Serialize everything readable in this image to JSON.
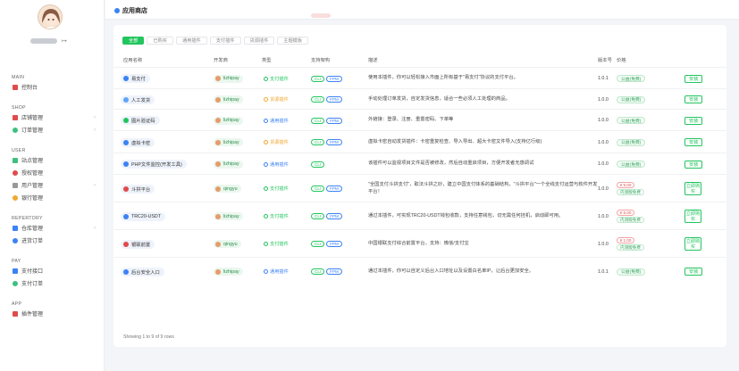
{
  "sidebar": {
    "logout_icon": "logout-icon",
    "sections": [
      {
        "label": "MAIN",
        "items": [
          {
            "label": "控制台",
            "icon": "home-icon",
            "color": "#e04b4b",
            "chevron": false
          }
        ]
      },
      {
        "label": "SHOP",
        "items": [
          {
            "label": "店铺管理",
            "icon": "shop-icon",
            "color": "#e04b4b",
            "chevron": true
          },
          {
            "label": "订单管理",
            "icon": "order-icon",
            "color": "#3fbf7f",
            "chevron": true
          }
        ]
      },
      {
        "label": "USER",
        "items": [
          {
            "label": "站点管理",
            "icon": "globe-icon",
            "color": "#3fbf7f",
            "chevron": false
          },
          {
            "label": "授权管理",
            "icon": "auth-icon",
            "color": "#e04b4b",
            "chevron": false
          },
          {
            "label": "用户管理",
            "icon": "users-icon",
            "color": "#999999",
            "chevron": true
          },
          {
            "label": "银行管理",
            "icon": "bank-icon",
            "color": "#f0a830",
            "chevron": false
          }
        ]
      },
      {
        "label": "REPERTORY",
        "items": [
          {
            "label": "仓库管理",
            "icon": "warehouse-icon",
            "color": "#3b82f6",
            "chevron": true
          },
          {
            "label": "进货订单",
            "icon": "purchase-icon",
            "color": "#3b82f6",
            "chevron": false
          }
        ]
      },
      {
        "label": "PAY",
        "items": [
          {
            "label": "支付接口",
            "icon": "pay-api-icon",
            "color": "#3b82f6",
            "chevron": false
          },
          {
            "label": "支付订单",
            "icon": "pay-order-icon",
            "color": "#3fbf7f",
            "chevron": false
          }
        ]
      },
      {
        "label": "APP",
        "items": [
          {
            "label": "插件管理",
            "icon": "plugin-icon",
            "color": "#e04b4b",
            "chevron": false
          }
        ]
      }
    ]
  },
  "header": {
    "title": "应用商店"
  },
  "tabs": [
    "全部",
    "已购买",
    "通用插件",
    "支付插件",
    "货源插件",
    "主题模板"
  ],
  "active_tab": 0,
  "columns": [
    "应用名称",
    "开发商",
    "类型",
    "支持架构",
    "描述",
    "版本号",
    "价格"
  ],
  "rows": [
    {
      "name": "易支付",
      "icon_color": "#3b82f6",
      "dev": "lizhipay",
      "type": "支付插件",
      "type_color": "#22c55e",
      "fw": [
        "CLI",
        "FPM"
      ],
      "desc": "使用本插件，你可以轻松接入市面上所有基于\"易支付\"协议的支付平台。",
      "version": "1.0.1",
      "price": "公益(免费)",
      "action": "安装",
      "paid": false
    },
    {
      "name": "人工发货",
      "icon_color": "#60a5fa",
      "dev": "lizhipay",
      "type": "货源插件",
      "type_color": "#f0a830",
      "fw": [
        "CLI",
        "FPM"
      ],
      "desc": "手动处理订单发货，自定发货信息，适合一些必须人工处理的商品。",
      "version": "1.0.0",
      "price": "公益(免费)",
      "action": "安装",
      "paid": false
    },
    {
      "name": "图片验证码",
      "icon_color": "#22c55e",
      "dev": "lizhipay",
      "type": "通用插件",
      "type_color": "#3b82f6",
      "fw": [
        "CLI",
        "FPM"
      ],
      "desc": "外链接：登录、注册、重置密码、下单等",
      "version": "1.0.0",
      "price": "公益(免费)",
      "action": "安装",
      "paid": false
    },
    {
      "name": "虚拟卡密",
      "icon_color": "#3b82f6",
      "dev": "lizhipay",
      "type": "货源插件",
      "type_color": "#f0a830",
      "fw": [
        "CLI",
        "FPM"
      ],
      "desc": "虚拟卡密自动发货插件：卡密重复检查、导入导出、超大卡密文件导入(支持亿行级)",
      "version": "1.0.0",
      "price": "公益(免费)",
      "action": "安装",
      "paid": false
    },
    {
      "name": "PHP文件监控(开发工具)",
      "icon_color": "#3b82f6",
      "dev": "lizhipay",
      "type": "通用插件",
      "type_color": "#3b82f6",
      "fw": [
        "CLI"
      ],
      "desc": "该插件可以监视项目文件是否被修改，然后自动重启项目，方便开发者无感调试",
      "version": "1.0.0",
      "price": "公益(免费)",
      "action": "安装",
      "paid": false
    },
    {
      "name": "斗拱平台",
      "icon_color": "#e04b4b",
      "dev": "qingyu",
      "type": "支付插件",
      "type_color": "#22c55e",
      "fw": [
        "CLI",
        "FPM"
      ],
      "desc": "\"全国支付斗拱支付\"，取法斗拱之妙，建立中国支付体系的基础结构，\"斗拱平台\"一个全线支付运营与软件开发平台！",
      "version": "1.0.0",
      "price": "¥ 5.00",
      "price_sub": "内测版免费",
      "action": "立即购买",
      "paid": true
    },
    {
      "name": "TRC20-USDT",
      "icon_color": "#3b82f6",
      "dev": "lizhipay",
      "type": "支付插件",
      "type_color": "#22c55e",
      "fw": [
        "CLI",
        "FPM"
      ],
      "desc": "通过本插件，可实现TRC20-USDT钱包收款，支持任意钱包，切无需任何挂机，启动即可用。",
      "version": "1.0.0",
      "price": "¥ 5.00",
      "price_sub": "内测版免费",
      "action": "立即购买",
      "paid": true
    },
    {
      "name": "银联前置",
      "icon_color": "#e04b4b",
      "dev": "qingyu",
      "type": "支付插件",
      "type_color": "#22c55e",
      "fw": [
        "CLI",
        "FPM"
      ],
      "desc": "中国银联支付综合前置平台，支持：微信/支付宝",
      "version": "1.0.0",
      "price": "¥ 1.00",
      "price_sub": "内测版免费",
      "action": "立即购买",
      "paid": true
    },
    {
      "name": "后台安全入口",
      "icon_color": "#3b82f6",
      "dev": "lizhipay",
      "type": "通用插件",
      "type_color": "#3b82f6",
      "fw": [
        "CLI",
        "FPM"
      ],
      "desc": "通过本插件，你可以自定义后台入口地址以及设置白名单IP，让后台更加安全。",
      "version": "1.0.1",
      "price": "公益(免费)",
      "action": "安装",
      "paid": false
    }
  ],
  "footer": "Showing 1 to 9 of 9 rows"
}
